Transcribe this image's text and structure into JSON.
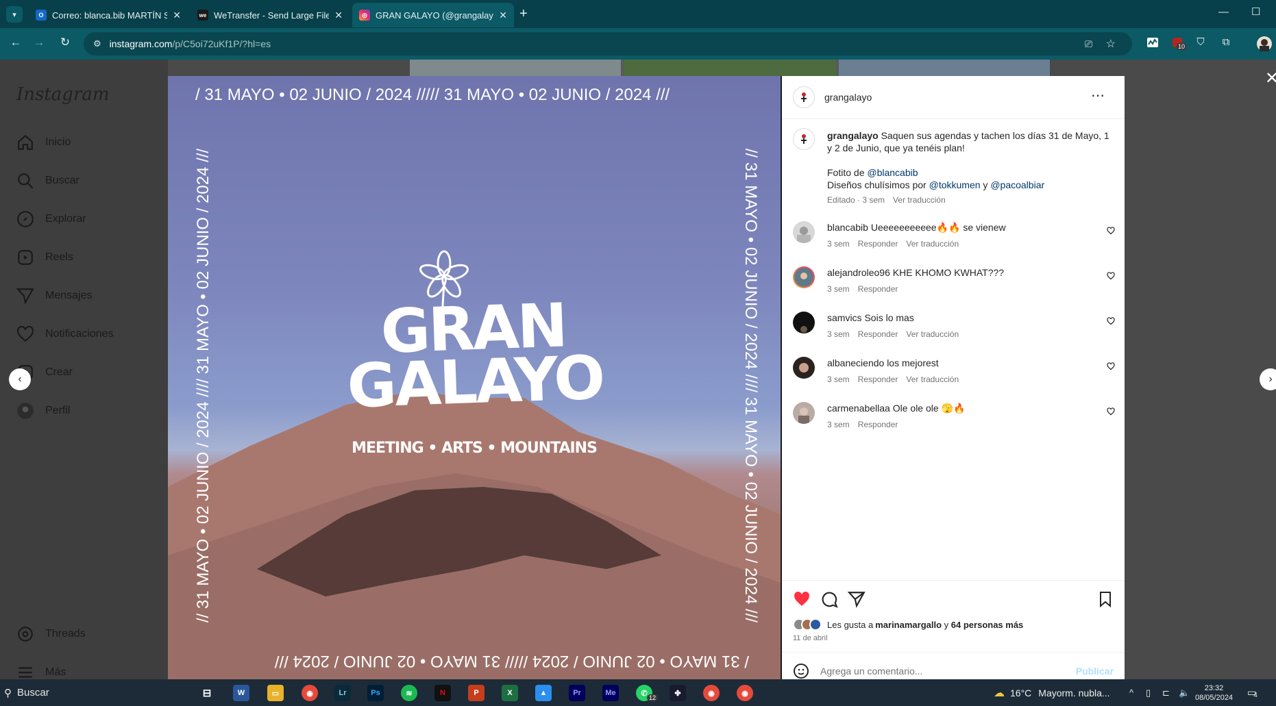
{
  "browser": {
    "tabs": [
      {
        "title": "Correo: blanca.bib MARTÍN SEC",
        "active": false
      },
      {
        "title": "WeTransfer - Send Large Files &",
        "active": false
      },
      {
        "title": "GRAN GALAYO (@grangalayo)",
        "active": true
      }
    ],
    "url_host": "instagram.com",
    "url_path": "/p/C5oi72uKf1P/?hl=es",
    "extension_badge": "10"
  },
  "sidebar": {
    "logo": "Instagram",
    "items": [
      {
        "label": "Inicio",
        "icon": "home-icon"
      },
      {
        "label": "Buscar",
        "icon": "search-icon"
      },
      {
        "label": "Explorar",
        "icon": "compass-icon"
      },
      {
        "label": "Reels",
        "icon": "reels-icon"
      },
      {
        "label": "Mensajes",
        "icon": "send-icon"
      },
      {
        "label": "Notificaciones",
        "icon": "heart-icon"
      },
      {
        "label": "Crear",
        "icon": "plus-icon"
      },
      {
        "label": "Perfil",
        "icon": "avatar"
      },
      {
        "label": "Threads",
        "icon": "threads-icon"
      },
      {
        "label": "Más",
        "icon": "menu-icon"
      }
    ]
  },
  "poster": {
    "border_top": "/ 31 MAYO • 02 JUNIO / 2024 /////   31 MAYO • 02 JUNIO / 2024 ///",
    "border_side": "// 31 MAYO • 02 JUNIO / 2024 //// 31 MAYO • 02 JUNIO / 2024 ///",
    "title_line1": "GRAN",
    "title_line2": "GALAYO",
    "tagline": "MEETING • ARTS • MOUNTAINS"
  },
  "post": {
    "author": "grangalayo",
    "caption_line1": "Saquen sus agendas y tachen los días 31 de Mayo, 1",
    "caption_line2": "y 2 de Junio, que ya tenéis plan!",
    "credit_prefix": "Fotito de ",
    "credit_mention": "@blancabib",
    "design_prefix": "Diseños chulísimos por ",
    "design_mention1": "@tokkumen",
    "design_and": " y ",
    "design_mention2": "@pacoalbiar",
    "edited_meta": "Editado · 3 sem",
    "see_translation": "Ver traducción",
    "comments": [
      {
        "user": "blancabib",
        "text": "Ueeeeeeeeeee🔥🔥 se vienew",
        "age": "3 sem",
        "reply": "Responder",
        "translate": "Ver traducción"
      },
      {
        "user": "alejandroleo96",
        "text": "KHE KHOMO KWHAT???",
        "age": "3 sem",
        "reply": "Responder",
        "translate": ""
      },
      {
        "user": "samvics",
        "text": "Sois lo mas",
        "age": "3 sem",
        "reply": "Responder",
        "translate": "Ver traducción"
      },
      {
        "user": "albaneciendo",
        "text": "los mejorest",
        "age": "3 sem",
        "reply": "Responder",
        "translate": "Ver traducción"
      },
      {
        "user": "carmenabellaa",
        "text": "Ole ole ole 🫣🔥",
        "age": "3 sem",
        "reply": "Responder",
        "translate": ""
      }
    ],
    "likes_prefix": "Les gusta a ",
    "likes_user": "marinamargallo",
    "likes_and": " y ",
    "likes_others": "64 personas más",
    "date": "11 de abril",
    "comment_placeholder": "Agrega un comentario...",
    "publish": "Publicar"
  },
  "taskbar": {
    "search": "Buscar",
    "weather_temp": "16°C",
    "weather_text": "Mayorm. nubla...",
    "time": "23:32",
    "date": "08/05/2024",
    "notifications": "4",
    "whatsapp_badge": "12"
  },
  "colors": {
    "chrome_tabbar": "#07404a",
    "chrome_toolbar": "#0b5a66",
    "like_red": "#ff3040",
    "mention_blue": "#00376b"
  }
}
